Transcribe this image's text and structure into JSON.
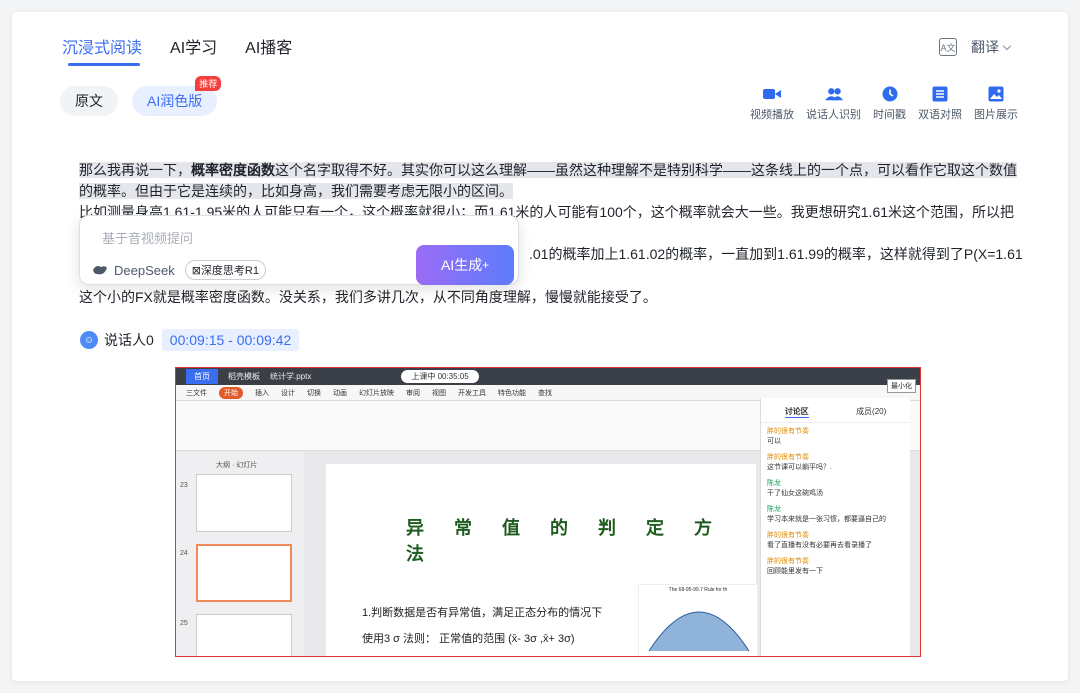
{
  "tabs": [
    "沉浸式阅读",
    "AI学习",
    "AI播客"
  ],
  "translate": {
    "icon": "translate-icon",
    "label": "翻译"
  },
  "modes": {
    "original": "原文",
    "ai": "AI润色版",
    "badge": "推荐"
  },
  "tools": [
    {
      "icon": "video-icon",
      "label": "视频播放"
    },
    {
      "icon": "people-icon",
      "label": "说话人识别"
    },
    {
      "icon": "clock-icon",
      "label": "时间戳"
    },
    {
      "icon": "bilingual-icon",
      "label": "双语对照"
    },
    {
      "icon": "image-icon",
      "label": "图片展示"
    }
  ],
  "transcript": {
    "p1_a": "那么我再说一下，",
    "p1_b": "概率密度函数",
    "p1_c": "这个名字取得不好。其实你可以这么理解——虽然这种理解不是特别科学——这条线上的一个点，可以看作它取这个数值",
    "p2": "的概率。但由于它是连续的，比如身高，我们需要考虑无限小的区间。",
    "p3": "比如测量身高1.61-1.95米的人可能只有一个，这个概率就很小；而1.61米的人可能有100个，这个概率就会大一些。我更想研究1.61米这个范围，所以把",
    "p4": ".01的概率加上1.61.02的概率，一直加到1.61.99的概率，这样就得到了P(X=1.61",
    "p5": "这个小的FX就是概率密度函数。没关系，我们多讲几次，从不同角度理解，慢慢就能接受了。"
  },
  "ask": {
    "placeholder": "基于音视频提问",
    "model": "DeepSeek",
    "deep": "深度思考R1",
    "generate": "AI生成"
  },
  "speaker": {
    "name": "说话人0",
    "time": "00:09:15 - 00:09:42"
  },
  "screenshot": {
    "tab_home": "首页",
    "tab_template": "稻壳模板",
    "tab_file": "统计学.pptx",
    "live": "上课中 00:35:05",
    "menu": [
      "三文件",
      "开始",
      "插入",
      "设计",
      "切换",
      "动画",
      "幻灯片放映",
      "审阅",
      "视图",
      "开发工具",
      "特色功能",
      "查找"
    ],
    "panel_tabs": [
      "大纲",
      "幻灯片"
    ],
    "slide_nums": [
      "23",
      "24",
      "25"
    ],
    "slide_title": "异常值的判定方法",
    "line1": "1.判断数据是否有异常值，满足正态分布的情况下",
    "line2": "使用3 σ 法则： 正常值的范围 (x̄- 3σ ,x̄+ 3σ)",
    "chart_title": "The 68-95-99.7 Rule for th",
    "chat_tabs": [
      "讨论区",
      "成员(20)"
    ],
    "minimize": "最小化",
    "messages": [
      {
        "name": "胖的很有节奏",
        "text": "可以"
      },
      {
        "name": "胖的很有节奏",
        "text": "这节课可以躺平吗？."
      },
      {
        "name": "陈龙",
        "text": "干了仙女这碗鸡汤"
      },
      {
        "name": "陈龙",
        "text": "学习本来就是一张习惯，都要逼自己的"
      },
      {
        "name": "胖的很有节奏",
        "text": "看了直播有没有必要再去看录播了"
      },
      {
        "name": "胖的很有节奏",
        "text": "回顾能里发有一下"
      }
    ]
  }
}
